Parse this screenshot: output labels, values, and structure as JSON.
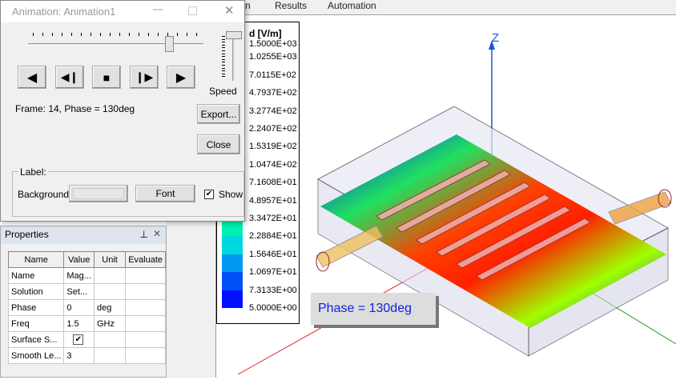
{
  "menu": {
    "items": [
      "n",
      "Results",
      "Automation"
    ]
  },
  "dialog": {
    "title": "Animation: Animation1",
    "frame_text": "Frame: 14, Phase = 130deg",
    "speed_label": "Speed",
    "export": "Export...",
    "close": "Close",
    "label_group": "Label:",
    "background_label": "Background:",
    "font": "Font",
    "show": "Show",
    "show_checked": true,
    "frame_slider_fraction": 0.8,
    "speed_slider_fraction": 1.0
  },
  "legend": {
    "title": "d [V/m]",
    "labels": [
      "1.5000E+03",
      "1.0255E+03",
      "7.0115E+02",
      "4.7937E+02",
      "3.2774E+02",
      "2.2407E+02",
      "1.5319E+02",
      "1.0474E+02",
      "7.1608E+01",
      "4.8957E+01",
      "3.3472E+01",
      "2.2884E+01",
      "1.5646E+01",
      "1.0697E+01",
      "7.3133E+00",
      "5.0000E+00"
    ],
    "colors": [
      "#ff0000",
      "#ff3c00",
      "#ff7800",
      "#ffb400",
      "#ffe000",
      "#d8ff00",
      "#9cff00",
      "#60ff00",
      "#20ff20",
      "#00ff70",
      "#00f0b0",
      "#00d8e0",
      "#0098f0",
      "#0050f8",
      "#0010ff"
    ]
  },
  "properties": {
    "title": "Properties",
    "columns": [
      "Name",
      "Value",
      "Unit",
      "Evaluate"
    ],
    "rows": [
      [
        "Name",
        "Mag...",
        "",
        ""
      ],
      [
        "Solution",
        "Set...",
        "",
        ""
      ],
      [
        "Phase",
        "0",
        "deg",
        ""
      ],
      [
        "Freq",
        "1.5",
        "GHz",
        ""
      ],
      [
        "Surface S...",
        "",
        "",
        ""
      ],
      [
        "Smooth Le...",
        "3",
        "",
        ""
      ]
    ],
    "surface_checked": true
  },
  "view": {
    "axis_z": "Z",
    "phase_label": "Phase = 130deg"
  }
}
